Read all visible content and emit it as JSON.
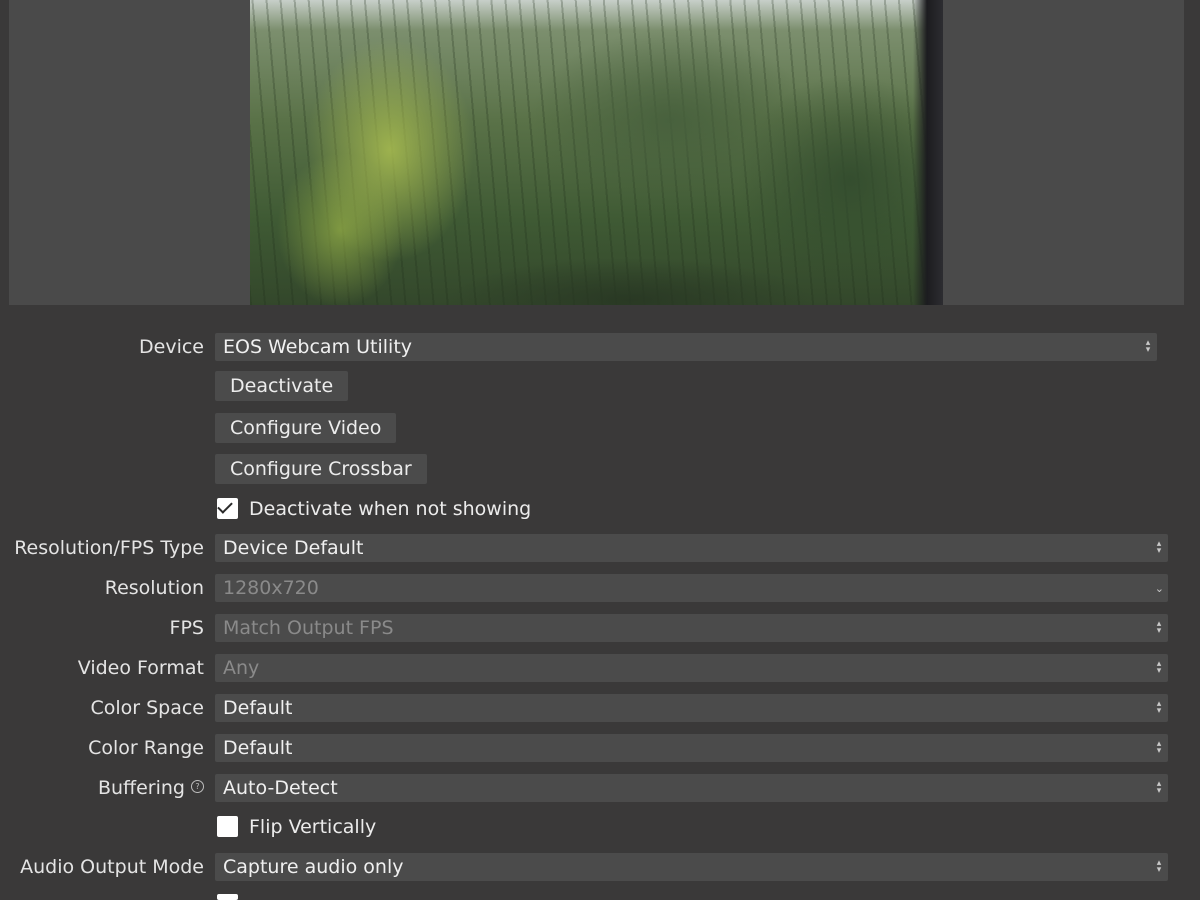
{
  "preview": {
    "icon": "webcam-preview-image"
  },
  "device": {
    "label": "Device",
    "value": "EOS Webcam Utility"
  },
  "buttons": {
    "deactivate": "Deactivate",
    "configure_video": "Configure Video",
    "configure_crossbar": "Configure Crossbar"
  },
  "deactivate_when_not_showing": {
    "label": "Deactivate when not showing",
    "checked": true
  },
  "resolution_fps_type": {
    "label": "Resolution/FPS Type",
    "value": "Device Default"
  },
  "resolution": {
    "label": "Resolution",
    "value": "1280x720"
  },
  "fps": {
    "label": "FPS",
    "value": "Match Output FPS"
  },
  "video_format": {
    "label": "Video Format",
    "value": "Any"
  },
  "color_space": {
    "label": "Color Space",
    "value": "Default"
  },
  "color_range": {
    "label": "Color Range",
    "value": "Default"
  },
  "buffering": {
    "label": "Buffering",
    "value": "Auto-Detect",
    "help_icon": "?"
  },
  "flip_vertically": {
    "label": "Flip Vertically",
    "checked": false
  },
  "audio_output_mode": {
    "label": "Audio Output Mode",
    "value": "Capture audio only"
  },
  "colors": {
    "background": "#3a3939",
    "control": "#4b4b4b",
    "disabled_text": "#8a8a8a"
  }
}
